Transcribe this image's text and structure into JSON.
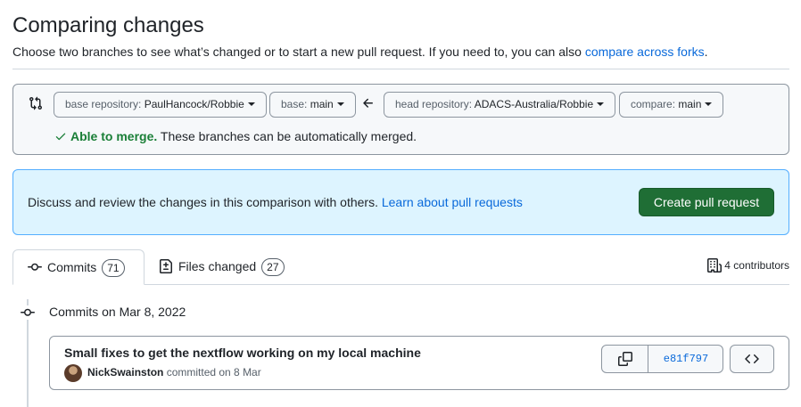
{
  "header": {
    "title": "Comparing changes",
    "subtitle": "Choose two branches to see what’s changed or to start a new pull request. If you need to, you can also ",
    "subtitle_link": "compare across forks",
    "subtitle_end": "."
  },
  "range": {
    "base_repo_label": "base repository: ",
    "base_repo_value": "PaulHancock/Robbie",
    "base_label": "base: ",
    "base_value": "main",
    "head_repo_label": "head repository: ",
    "head_repo_value": "ADACS-Australia/Robbie",
    "compare_label": "compare: ",
    "compare_value": "main",
    "merge_status": "Able to merge.",
    "merge_detail": " These branches can be automatically merged."
  },
  "pr_prompt": {
    "text": "Discuss and review the changes in this comparison with others. ",
    "link": "Learn about pull requests",
    "button": "Create pull request"
  },
  "tabs": [
    {
      "label": "Commits",
      "count": "71"
    },
    {
      "label": "Files changed",
      "count": "27"
    }
  ],
  "contributors": "4 contributors",
  "commit_group": {
    "date_heading": "Commits on Mar 8, 2022",
    "commits": [
      {
        "message": "Small fixes to get the nextflow working on my local machine",
        "author": "NickSwainston",
        "action": " committed on 8 Mar",
        "sha": "e81f797"
      }
    ]
  },
  "colors": {
    "link": "#0969da",
    "success": "#1a7f37",
    "primary_button": "#1f6e35",
    "info_bg": "#ddf4ff"
  }
}
